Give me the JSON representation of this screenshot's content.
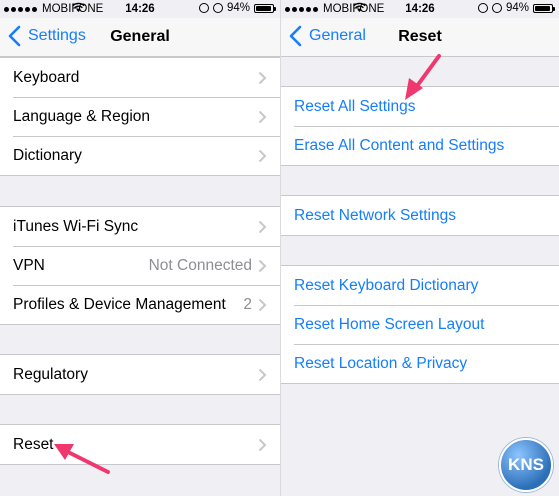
{
  "status": {
    "carrier": "MOBIFONE",
    "time": "14:26",
    "battery": "94%"
  },
  "left": {
    "back": "Settings",
    "title": "General",
    "groups": [
      [
        {
          "label": "Keyboard"
        },
        {
          "label": "Language & Region"
        },
        {
          "label": "Dictionary"
        }
      ],
      [
        {
          "label": "iTunes Wi-Fi Sync"
        },
        {
          "label": "VPN",
          "detail": "Not Connected"
        },
        {
          "label": "Profiles & Device Management",
          "detail": "2"
        }
      ],
      [
        {
          "label": "Regulatory"
        }
      ],
      [
        {
          "label": "Reset"
        }
      ]
    ]
  },
  "right": {
    "back": "General",
    "title": "Reset",
    "groups": [
      [
        {
          "label": "Reset All Settings"
        },
        {
          "label": "Erase All Content and Settings"
        }
      ],
      [
        {
          "label": "Reset Network Settings"
        }
      ],
      [
        {
          "label": "Reset Keyboard Dictionary"
        },
        {
          "label": "Reset Home Screen Layout"
        },
        {
          "label": "Reset Location & Privacy"
        }
      ]
    ]
  },
  "watermark": "KNS",
  "colors": {
    "accent": "#157efb",
    "arrow": "#f0376e",
    "background": "#efeff4"
  }
}
